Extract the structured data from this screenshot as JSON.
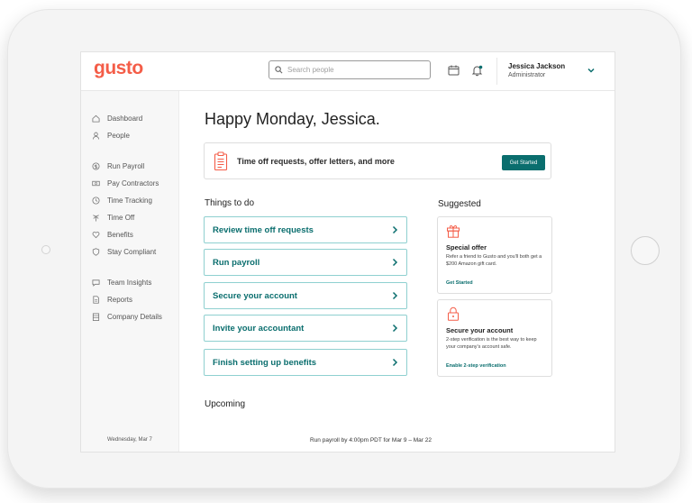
{
  "app": {
    "logo": "gusto"
  },
  "search": {
    "placeholder": "Search people"
  },
  "user": {
    "name": "Jessica Jackson",
    "role": "Administrator"
  },
  "sidebar": {
    "items": [
      {
        "label": "Dashboard",
        "icon": "home-icon"
      },
      {
        "label": "People",
        "icon": "person-icon"
      },
      {
        "label": "Run Payroll",
        "icon": "dollar-icon"
      },
      {
        "label": "Pay Contractors",
        "icon": "cash-icon"
      },
      {
        "label": "Time Tracking",
        "icon": "clock-icon"
      },
      {
        "label": "Time Off",
        "icon": "palm-icon"
      },
      {
        "label": "Benefits",
        "icon": "heart-icon"
      },
      {
        "label": "Stay Compliant",
        "icon": "shield-icon"
      },
      {
        "label": "Team Insights",
        "icon": "chat-icon"
      },
      {
        "label": "Reports",
        "icon": "document-icon"
      },
      {
        "label": "Company Details",
        "icon": "building-icon"
      }
    ]
  },
  "main": {
    "greeting": "Happy Monday, Jessica.",
    "banner": {
      "text": "Time off requests, offer letters, and more",
      "button": "Get Started"
    },
    "todo_title": "Things to do",
    "todos": [
      "Review time off requests",
      "Run payroll",
      "Secure your account",
      "Invite your accountant",
      "Finish setting up benefits"
    ],
    "suggested_title": "Suggested",
    "cards": [
      {
        "icon": "gift-icon",
        "title": "Special offer",
        "body": "Refer a friend to Gusto and you'll both get a $200 Amazon gift card.",
        "link": "Get Started"
      },
      {
        "icon": "lock-icon",
        "title": "Secure your account",
        "body": "2-step verification is the best way to keep your company's account safe.",
        "link": "Enable 2-step verification"
      }
    ],
    "upcoming_title": "Upcoming",
    "upcoming": {
      "date": "Wednesday, Mar 7",
      "text": "Run payroll by 4:00pm PDT for Mar 9 – Mar 22"
    }
  },
  "colors": {
    "brand": "#f45d48",
    "accent": "#0a6e6e",
    "accent_border": "#8fd0d0"
  }
}
